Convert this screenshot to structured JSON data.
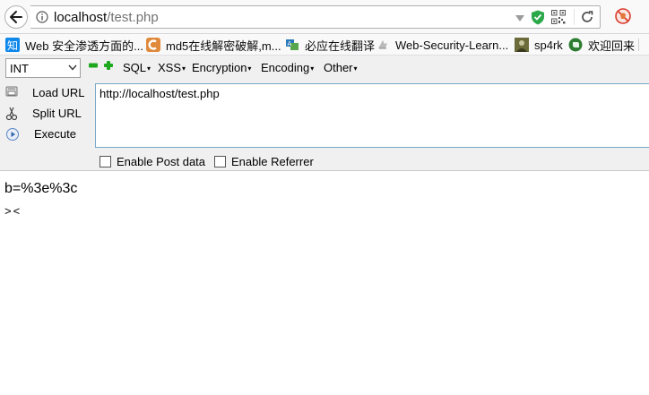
{
  "browser": {
    "url_host": "localhost",
    "url_path": "/test.php"
  },
  "bookmarks": [
    {
      "label": "Web 安全渗透方面的...",
      "icon": "zhihu-icon",
      "badge": "知",
      "color": "#0f88eb"
    },
    {
      "label": "md5在线解密破解,m...",
      "icon": "md5-site-icon",
      "color": "#e0893b"
    },
    {
      "label": "必应在线翻译",
      "icon": "bing-translate-icon",
      "color": "#2a7ab9"
    },
    {
      "label": "Web-Security-Learn...",
      "icon": "github-icon",
      "color": "#777777"
    },
    {
      "label": "sp4rk",
      "icon": "avatar-icon",
      "color": "#6b6b3b"
    },
    {
      "label": "欢迎回来",
      "icon": "evernote-icon",
      "color": "#2e7d32"
    }
  ],
  "hackbar": {
    "select_value": "INT",
    "menus": [
      "SQL",
      "XSS",
      "Encryption",
      "Encoding",
      "Other"
    ],
    "load_url": "Load URL",
    "split_url": "Split URL",
    "execute": "Execute",
    "url_value": "http://localhost/test.php",
    "enable_post": "Enable Post data",
    "enable_referrer": "Enable Referrer"
  },
  "page": {
    "line1": "b=%3e%3c",
    "line2": "><"
  }
}
